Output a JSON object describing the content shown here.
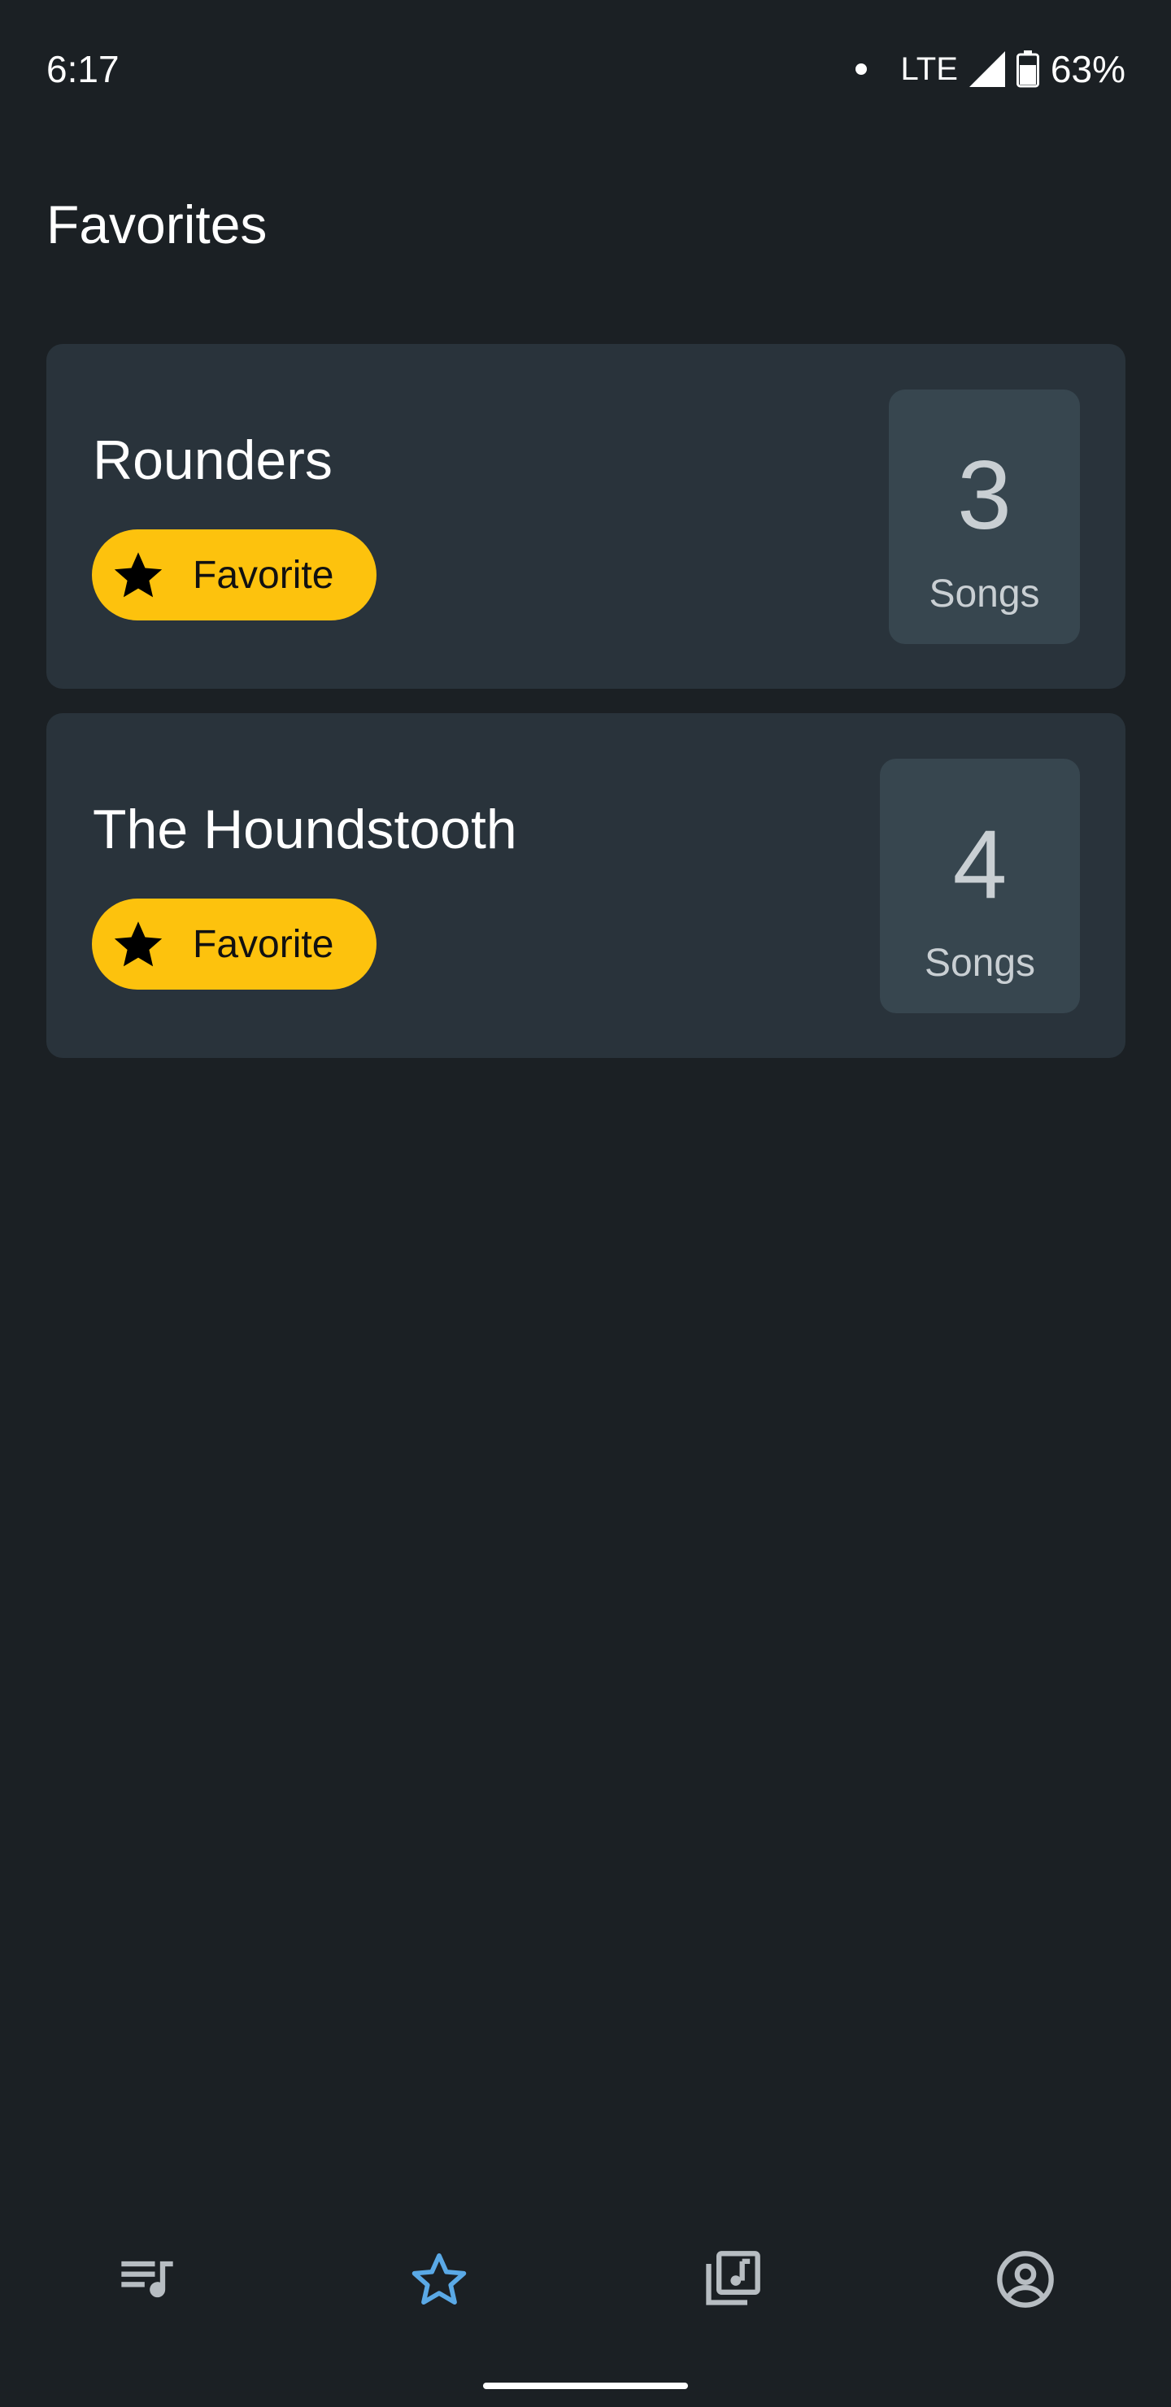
{
  "status_bar": {
    "time": "6:17",
    "network": "LTE",
    "battery": "63%"
  },
  "page": {
    "title": "Favorites"
  },
  "playlists": [
    {
      "name": "Rounders",
      "tag": "Favorite",
      "count": "3",
      "count_label": "Songs"
    },
    {
      "name": "The Houndstooth",
      "tag": "Favorite",
      "count": "4",
      "count_label": "Songs"
    }
  ],
  "bottom_nav": {
    "items": [
      {
        "icon": "queue-music-icon",
        "active": false
      },
      {
        "icon": "star-outline-icon",
        "active": true
      },
      {
        "icon": "library-music-icon",
        "active": false
      },
      {
        "icon": "account-circle-icon",
        "active": false
      }
    ]
  },
  "colors": {
    "background": "#1b2024",
    "card": "#29333b",
    "count_box": "#37464f",
    "chip": "#fdc20d",
    "active_nav": "#5aa9e6",
    "inactive_nav": "#b7bdc2"
  }
}
